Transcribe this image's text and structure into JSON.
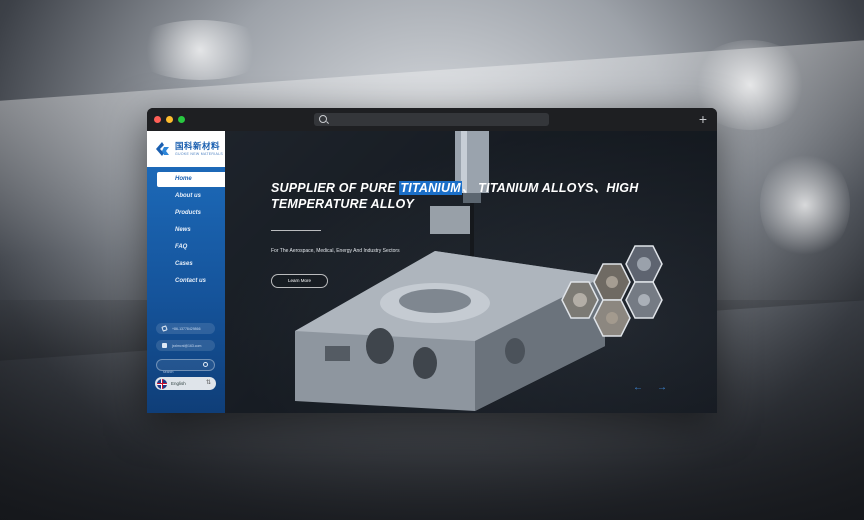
{
  "brand": {
    "name_cn": "国科新材料",
    "name_en": "GUOKE NEW MATERIALS",
    "primary_color": "#1b6fc8"
  },
  "nav": {
    "items": [
      {
        "label": "Home",
        "active": true
      },
      {
        "label": "About  us"
      },
      {
        "label": "Products"
      },
      {
        "label": "News"
      },
      {
        "label": "FAQ"
      },
      {
        "label": "Cases"
      },
      {
        "label": "Contact  us"
      }
    ]
  },
  "contact": {
    "phone": "+86-13778429866",
    "email": "jxxlmcnl@163.com"
  },
  "search": {
    "placeholder": "search"
  },
  "language": {
    "label": "English"
  },
  "hero": {
    "title_before": "SUPPLIER OF PURE ",
    "title_highlight": "TITANIUM",
    "title_after": "、 TITANIUM ALLOYS、HIGH TEMPERATURE ALLOY",
    "subtitle": "For The Aerospace, Medical, Energy And Industry Sectors",
    "button_label": "Learn More",
    "prev_arrow": "←",
    "next_arrow": "→"
  },
  "window": {
    "new_tab_icon": "plus-icon"
  }
}
